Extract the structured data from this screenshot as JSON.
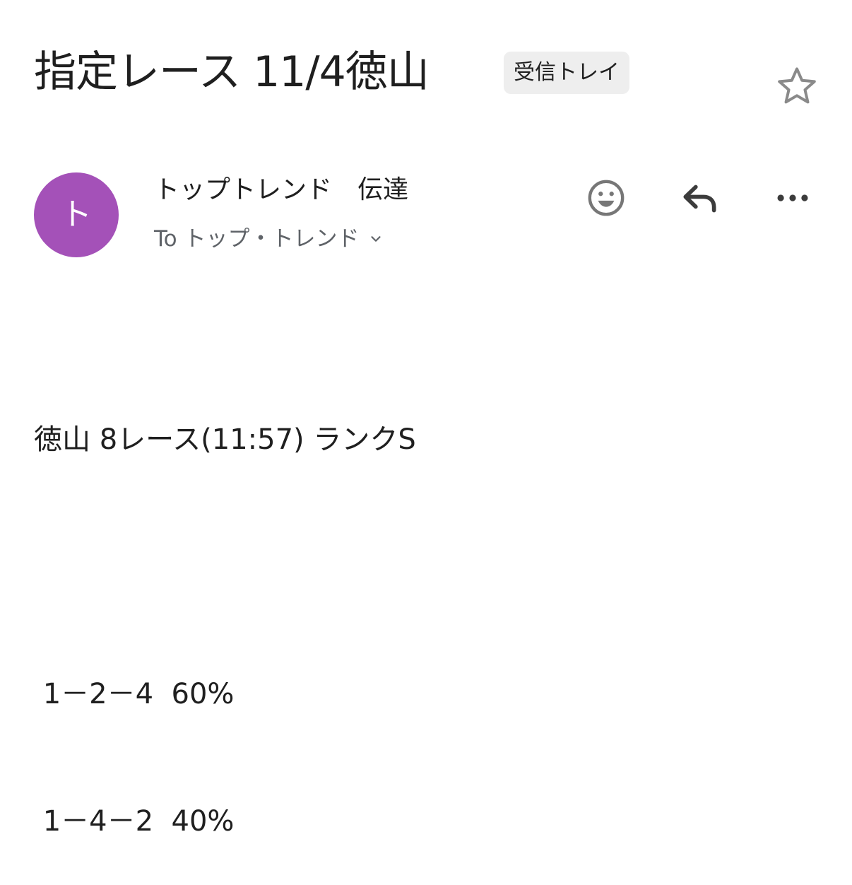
{
  "email": {
    "subject": "指定レース 11/4徳山",
    "label": "受信トレイ",
    "sender": {
      "avatar_initial": "ト",
      "avatar_color": "#a451b8",
      "name": "トップトレンド　伝達",
      "recipient": "To トップ・トレンド"
    },
    "actions": {
      "star_icon": "star-outline-icon",
      "emoji_icon": "emoji-smile-icon",
      "reply_icon": "reply-icon",
      "more_icon": "more-horiz-icon"
    },
    "body_lines": [
      "徳山 8レース(11:57) ランクS",
      "",
      " 1－2－4  60%",
      " 1－4－2  40%"
    ]
  }
}
